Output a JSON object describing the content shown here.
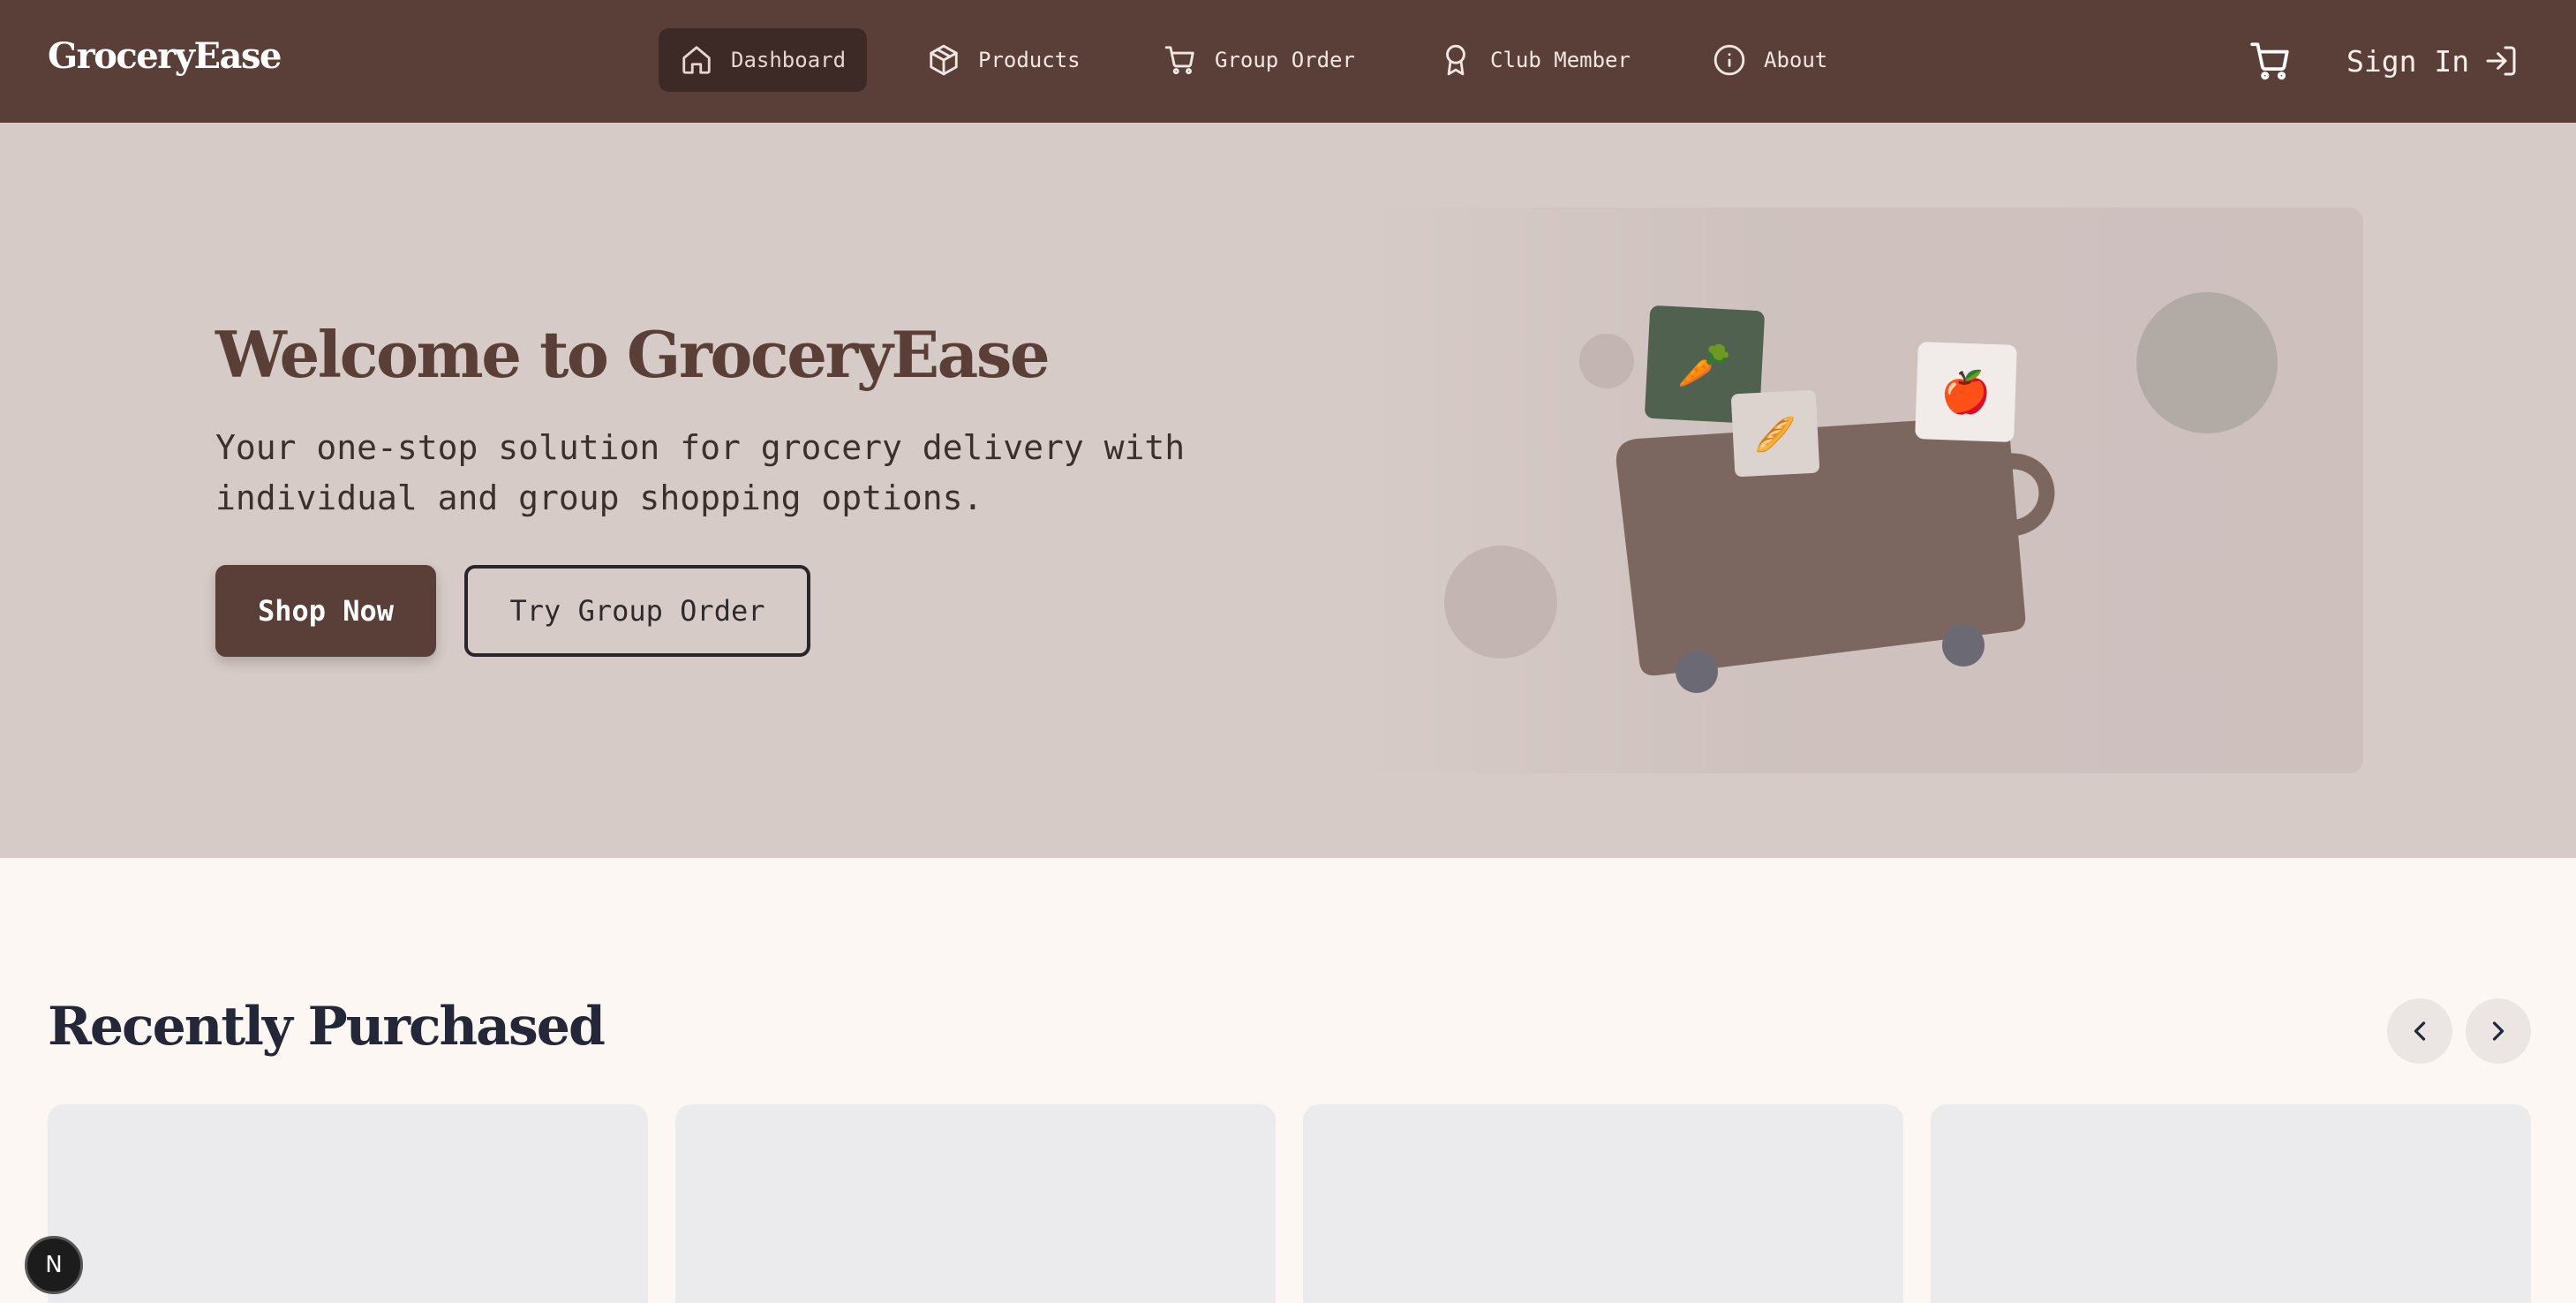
{
  "nav": {
    "logo": "GroceryEase",
    "items": [
      {
        "label": "Dashboard",
        "icon": "home-icon",
        "active": true
      },
      {
        "label": "Products",
        "icon": "box-icon",
        "active": false
      },
      {
        "label": "Group Order",
        "icon": "cart-icon",
        "active": false
      },
      {
        "label": "Club Member",
        "icon": "award-icon",
        "active": false
      },
      {
        "label": "About",
        "icon": "info-icon",
        "active": false
      }
    ],
    "cart_icon": "shopping-cart-icon",
    "signin_label": "Sign In"
  },
  "hero": {
    "title": "Welcome to GroceryEase",
    "subtitle": "Your one-stop solution for grocery delivery with individual and group shopping options.",
    "primary_button": "Shop Now",
    "secondary_button": "Try Group Order",
    "illustration_items": [
      "🥕",
      "🥖",
      "🍎"
    ]
  },
  "recent": {
    "title": "Recently Purchased"
  },
  "dev_badge": "N",
  "colors": {
    "nav_bg": "#5a3f38",
    "hero_bg": "#d7cbc7",
    "accent": "#5a3f38",
    "page_bg": "#fcf7f3"
  }
}
